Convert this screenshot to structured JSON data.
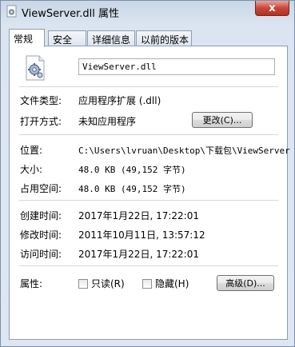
{
  "window": {
    "title": "ViewServer.dll 属性",
    "close_glyph": "x"
  },
  "tabs": [
    {
      "label": "常规",
      "active": true
    },
    {
      "label": "安全",
      "active": false
    },
    {
      "label": "详细信息",
      "active": false
    },
    {
      "label": "以前的版本",
      "active": false
    }
  ],
  "general": {
    "filename": "ViewServer.dll",
    "file_icon": "dll-settings-icon",
    "file_type_label": "文件类型:",
    "file_type_value": "应用程序扩展 (.dll)",
    "open_with_label": "打开方式:",
    "open_with_value": "未知应用程序",
    "change_button": "更改(C)...",
    "location_label": "位置:",
    "location_value": "C:\\Users\\lvruan\\Desktop\\下载包\\ViewServer",
    "size_label": "大小:",
    "size_value": "48.0 KB (49,152 字节)",
    "size_on_disk_label": "占用空间:",
    "size_on_disk_value": "48.0 KB (49,152 字节)",
    "created_label": "创建时间:",
    "created_value": "2017年1月22日, 17:22:01",
    "modified_label": "修改时间:",
    "modified_value": "2011年10月11日, 13:57:12",
    "accessed_label": "访问时间:",
    "accessed_value": "2017年1月22日, 17:22:01",
    "attributes_label": "属性:",
    "readonly_label": "只读(R)",
    "hidden_label": "隐藏(H)",
    "advanced_button": "高级(D)..."
  },
  "colors": {
    "close_button": "#c8473a",
    "window_frame": "#d3dde9"
  }
}
